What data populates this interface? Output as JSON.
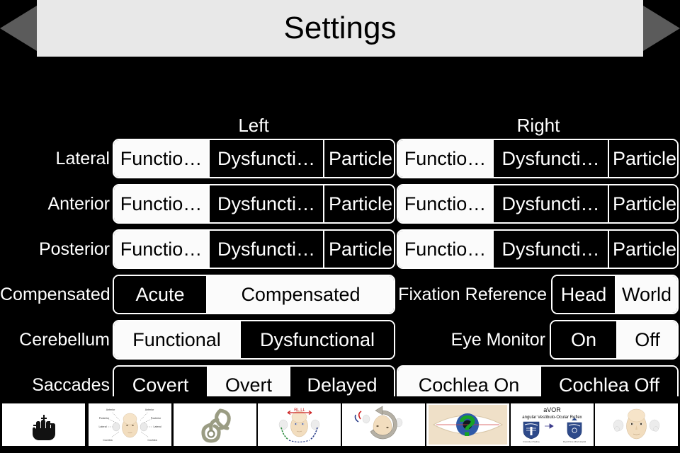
{
  "header": {
    "title": "Settings",
    "prev_label": "previous",
    "next_label": "next",
    "bar_color": "#e8e8e8",
    "arrow_color": "#5b5b5b"
  },
  "columns": {
    "left": "Left",
    "right": "Right"
  },
  "canals": {
    "rows": [
      {
        "label": "Lateral",
        "left": {
          "options": [
            "Functio…",
            "Dysfuncti…",
            "Particle"
          ],
          "selected": 0
        },
        "right": {
          "options": [
            "Functio…",
            "Dysfuncti…",
            "Particle"
          ],
          "selected": 0
        }
      },
      {
        "label": "Anterior",
        "left": {
          "options": [
            "Functio…",
            "Dysfuncti…",
            "Particle"
          ],
          "selected": 0
        },
        "right": {
          "options": [
            "Functio…",
            "Dysfuncti…",
            "Particle"
          ],
          "selected": 0
        }
      },
      {
        "label": "Posterior",
        "left": {
          "options": [
            "Functio…",
            "Dysfuncti…",
            "Particle"
          ],
          "selected": 0
        },
        "right": {
          "options": [
            "Functio…",
            "Dysfuncti…",
            "Particle"
          ],
          "selected": 0
        }
      }
    ]
  },
  "left_controls": {
    "compensated": {
      "label": "Compensated",
      "options": [
        "Acute",
        "Compensated"
      ],
      "selected": 1
    },
    "cerebellum": {
      "label": "Cerebellum",
      "options": [
        "Functional",
        "Dysfunctional"
      ],
      "selected": 0
    },
    "saccades": {
      "label": "Saccades",
      "options": [
        "Covert",
        "Overt",
        "Delayed"
      ],
      "selected": 1
    }
  },
  "right_controls": {
    "fixation": {
      "label": "Fixation Reference",
      "options": [
        "Head",
        "World"
      ],
      "selected": 1
    },
    "eye_monitor": {
      "label": "Eye Monitor",
      "options": [
        "On",
        "Off"
      ],
      "selected": 1
    },
    "cochlea": {
      "options": [
        "Cochlea On",
        "Cochlea Off"
      ],
      "selected": 0
    }
  },
  "toolbar": {
    "items": [
      {
        "name": "hand-gesture-thumbnail",
        "title": "Gestures"
      },
      {
        "name": "head-canals-thumbnail",
        "title": "Canal orientation"
      },
      {
        "name": "labyrinth-thumbnail",
        "title": "Labyrinth"
      },
      {
        "name": "head-rl-ll-thumbnail",
        "title": "RL LL"
      },
      {
        "name": "head-rotation-thumbnail",
        "title": "Rotation"
      },
      {
        "name": "eye-question-thumbnail",
        "title": "Quiz"
      },
      {
        "name": "avor-about-thumbnail",
        "title": "About aVOR"
      },
      {
        "name": "head-ears-thumbnail",
        "title": "Head"
      }
    ],
    "head_diagram_labels": {
      "anterior_left": "Anterior",
      "anterior_right": "Anterior",
      "posterior": "Posterior",
      "posterior_right": "Posterior",
      "lateral_left": "Lateral",
      "lateral_right": "Lateral",
      "cochlea_left": "Cochlea",
      "cochlea_right": "Cochlea"
    },
    "rl_ll_label": "RL LL",
    "avor": {
      "title": "aVOR",
      "subtitle": "angular Vestibulo-Ocular Reflex",
      "crest_left_caption": "University of Sydney",
      "crest_right_caption": "Royal Prince Alfred Hospital"
    }
  }
}
